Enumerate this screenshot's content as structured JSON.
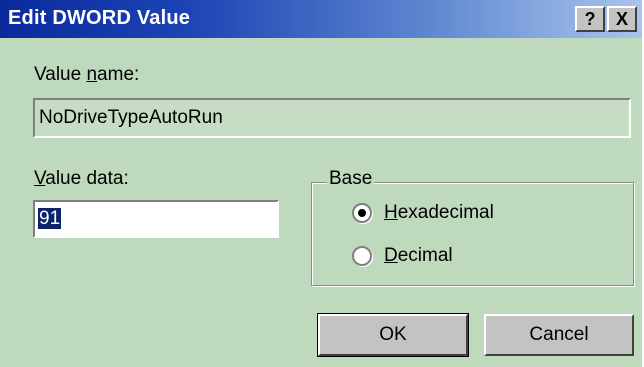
{
  "dialog": {
    "title": "Edit DWORD Value",
    "help_label": "?",
    "close_label": "X"
  },
  "value_name": {
    "label_underlined": "n",
    "label_prefix": "Value ",
    "label_suffix": "ame:",
    "value": "NoDriveTypeAutoRun"
  },
  "value_data": {
    "label_underlined": "V",
    "label_suffix": "alue data:",
    "value": "91"
  },
  "base": {
    "legend": "Base",
    "options": [
      {
        "underlined": "H",
        "rest": "exadecimal",
        "selected": true
      },
      {
        "underlined": "D",
        "rest": "ecimal",
        "selected": false
      }
    ]
  },
  "buttons": {
    "ok_label": "OK",
    "cancel_label": "Cancel"
  },
  "colors": {
    "dialog_background": "#bfd9bd",
    "titlebar_start": "#0a2a9c",
    "titlebar_end": "#a9c4ec",
    "selection": "#0a246a"
  }
}
